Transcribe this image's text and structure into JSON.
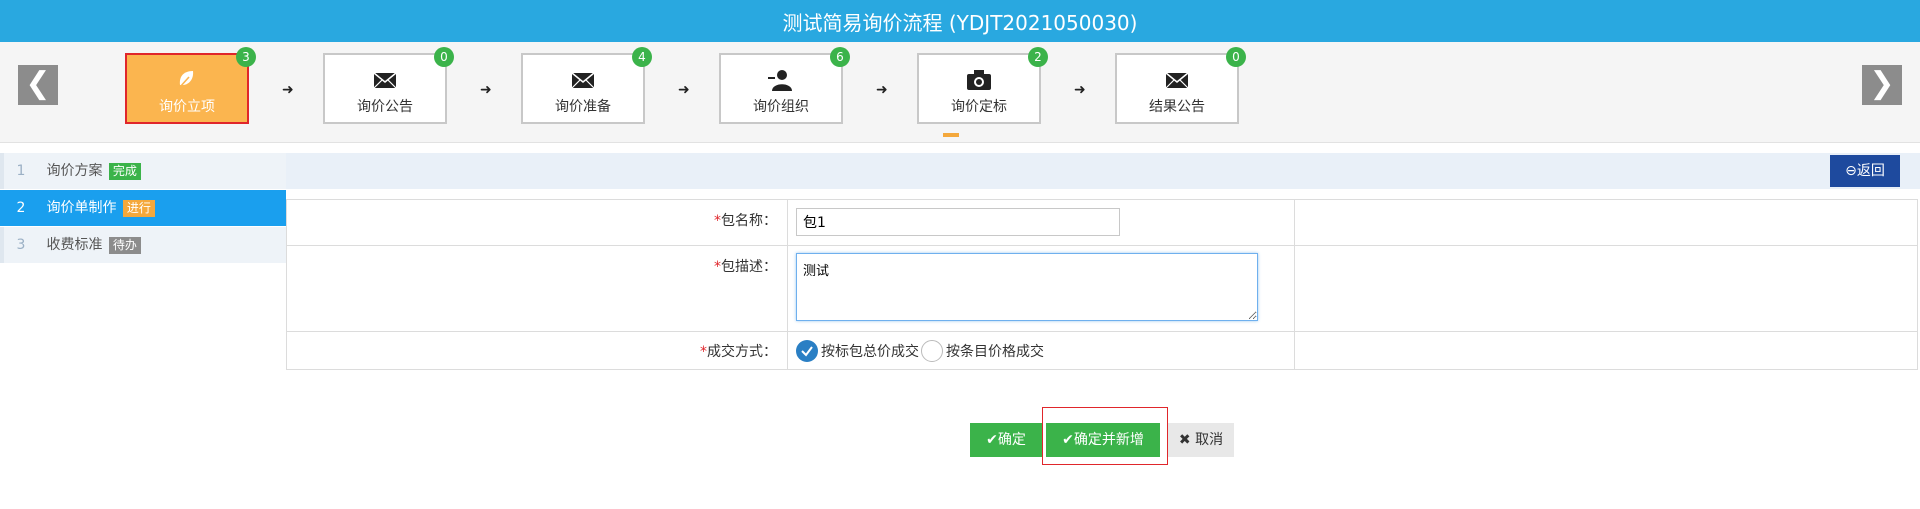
{
  "window": {
    "title": "测试简易询价流程 (YDJT2021050030)"
  },
  "nav": {
    "prev_icon": "chevron-left-icon",
    "next_icon": "chevron-right-icon",
    "prev_glyph": "❮",
    "next_glyph": "❯"
  },
  "steps": [
    {
      "label": "询价立项",
      "count": "3",
      "icon": "leaf-icon",
      "active": true
    },
    {
      "label": "询价公告",
      "count": "0",
      "icon": "envelope-icon",
      "active": false
    },
    {
      "label": "询价准备",
      "count": "4",
      "icon": "envelope-icon",
      "active": false
    },
    {
      "label": "询价组织",
      "count": "6",
      "icon": "user-icon",
      "active": false
    },
    {
      "label": "询价定标",
      "count": "2",
      "icon": "camera-icon",
      "active": false
    },
    {
      "label": "结果公告",
      "count": "0",
      "icon": "envelope-icon",
      "active": false
    }
  ],
  "step_separator": "➜",
  "sidebar": {
    "items": [
      {
        "num": "1",
        "label": "询价方案",
        "status": "完成"
      },
      {
        "num": "2",
        "label": "询价单制作",
        "status": "进行"
      },
      {
        "num": "3",
        "label": "收费标准",
        "status": "待办"
      }
    ]
  },
  "header": {
    "back_label": "⊖返回"
  },
  "form": {
    "required_mark": "*",
    "package_name": {
      "label": "包名称：",
      "value": "包1"
    },
    "package_desc": {
      "label": "包描述：",
      "value": "测试"
    },
    "deal_method": {
      "label": "成交方式：",
      "options": [
        {
          "label": "按标包总价成交",
          "selected": true
        },
        {
          "label": "按条目价格成交",
          "selected": false
        }
      ]
    }
  },
  "actions": {
    "confirm_label": "✔确定",
    "confirm_new_label": "✔确定并新增",
    "cancel_label": "✖ 取消"
  },
  "colors": {
    "title_bar": "#29a8e0",
    "active_step": "#fbb54f",
    "badge": "#3bb34a",
    "sidebar_current": "#1a9fee",
    "back_button": "#1e4a9e",
    "highlight": "#e0262b"
  }
}
